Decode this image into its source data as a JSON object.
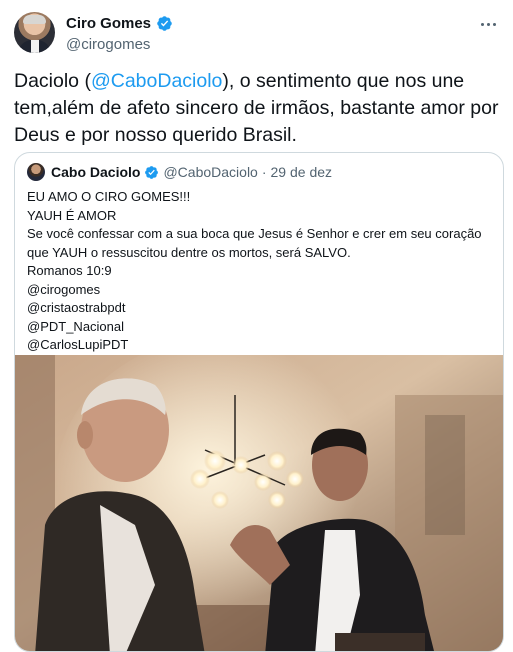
{
  "tweet": {
    "author_name": "Ciro Gomes",
    "author_handle": "@cirogomes",
    "text_prefix": "Daciolo (",
    "text_mention": "@CaboDaciolo",
    "text_suffix": "), o sentimento que nos une tem,além de afeto sincero de irmãos, bastante amor por Deus e por nosso querido Brasil."
  },
  "quoted": {
    "author_name": "Cabo Daciolo",
    "author_handle": "@CaboDaciolo",
    "separator": "·",
    "date": "29 de dez",
    "lines": [
      "EU AMO O CIRO GOMES!!!",
      "YAUH É AMOR",
      "Se você confessar com a sua boca que Jesus é Senhor e crer em seu coração",
      "que YAUH o ressuscitou dentre os mortos, será SALVO.",
      "Romanos 10:9",
      "@cirogomes",
      "@cristaostrabpdt",
      "@PDT_Nacional",
      "@CarlosLupiPDT"
    ]
  },
  "icons": {
    "verified": "verified-badge-icon",
    "more": "more-options-icon"
  },
  "colors": {
    "accent": "#1d9bf0",
    "text": "#0f1419",
    "secondary": "#536471",
    "border": "#cfd9de"
  }
}
